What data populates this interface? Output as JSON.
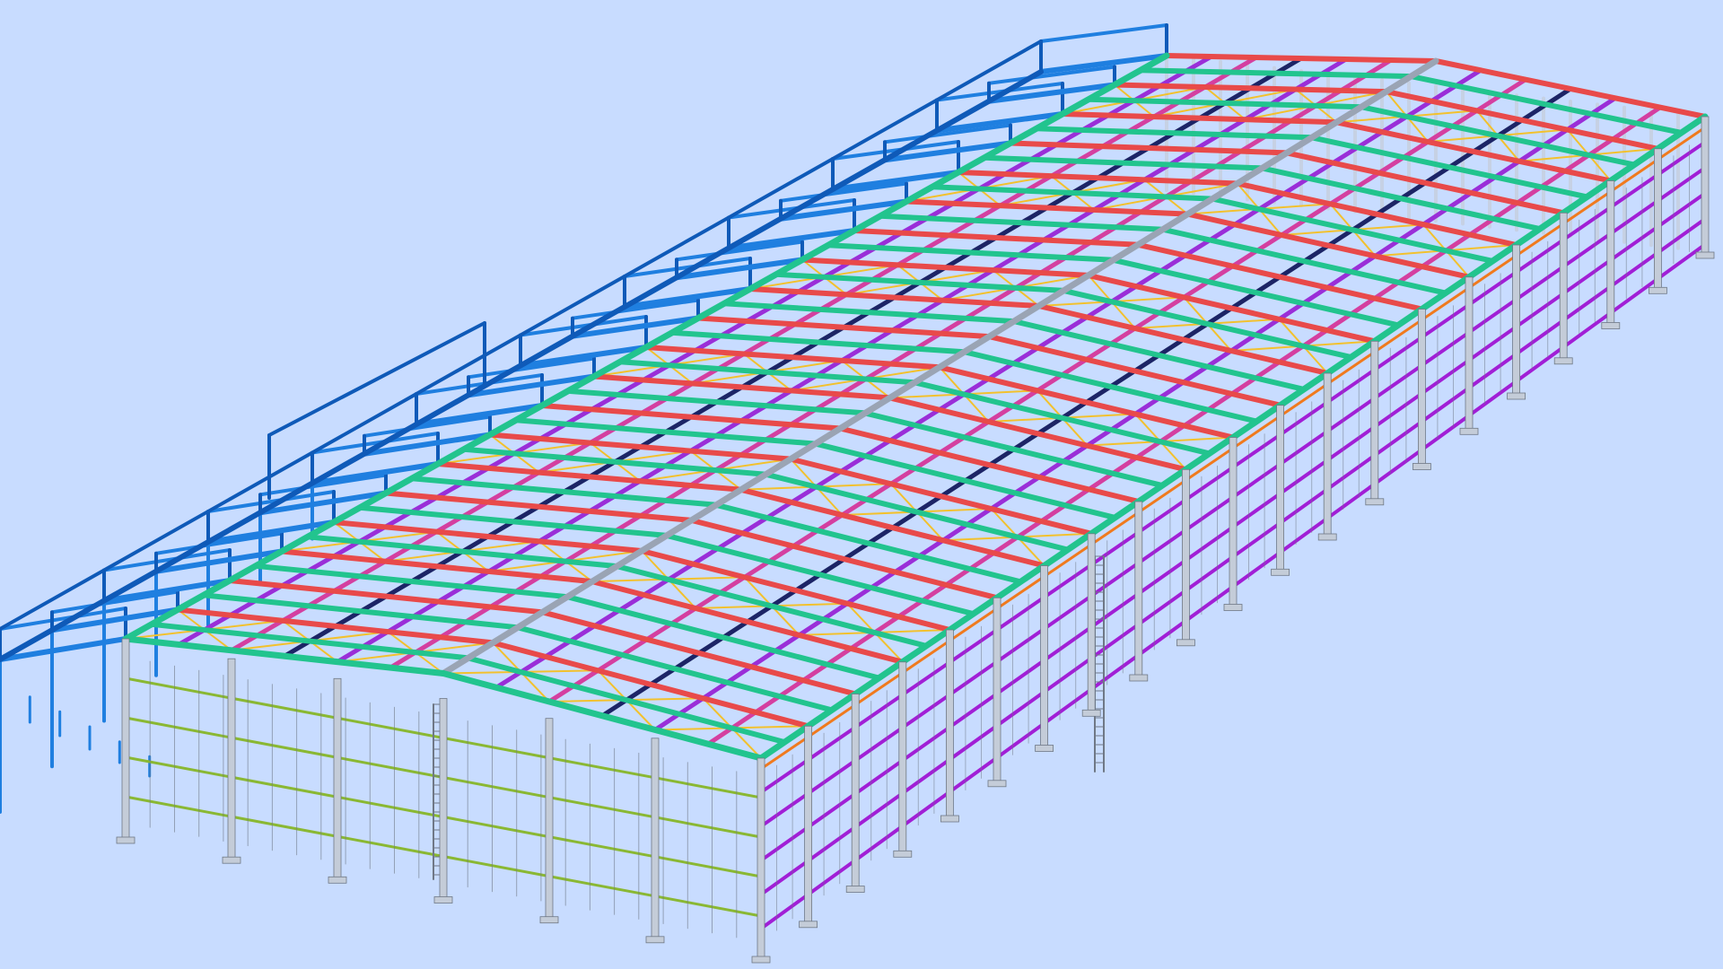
{
  "viewport": {
    "background": "#c8dcff",
    "model_kind": "3D steel frame structure",
    "colors": {
      "column": "#c4ccd8",
      "column_edge": "#6f7886",
      "rafter": "#e84a4a",
      "eave_beam": "#22c48e",
      "purlin": "#9a2ed8",
      "secondary": "#d43fa0",
      "dark_beam": "#1c2466",
      "brace": "#f2c12e",
      "annex_frame": "#1f7fe0",
      "annex_edge": "#0f5ab8",
      "gable_rail": "#8ab833",
      "eave_strip": "#f07a1e",
      "ridge": "#9aa4b4",
      "cladding_rail": "#a11fd6"
    }
  }
}
